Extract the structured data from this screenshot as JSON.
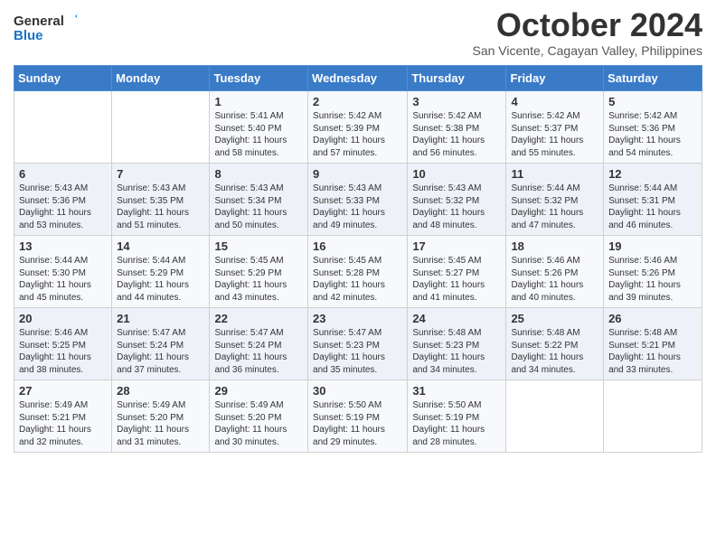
{
  "logo": {
    "line1": "General",
    "line2": "Blue"
  },
  "title": "October 2024",
  "subtitle": "San Vicente, Cagayan Valley, Philippines",
  "days_of_week": [
    "Sunday",
    "Monday",
    "Tuesday",
    "Wednesday",
    "Thursday",
    "Friday",
    "Saturday"
  ],
  "weeks": [
    [
      {
        "day": "",
        "content": ""
      },
      {
        "day": "",
        "content": ""
      },
      {
        "day": "1",
        "content": "Sunrise: 5:41 AM\nSunset: 5:40 PM\nDaylight: 11 hours and 58 minutes."
      },
      {
        "day": "2",
        "content": "Sunrise: 5:42 AM\nSunset: 5:39 PM\nDaylight: 11 hours and 57 minutes."
      },
      {
        "day": "3",
        "content": "Sunrise: 5:42 AM\nSunset: 5:38 PM\nDaylight: 11 hours and 56 minutes."
      },
      {
        "day": "4",
        "content": "Sunrise: 5:42 AM\nSunset: 5:37 PM\nDaylight: 11 hours and 55 minutes."
      },
      {
        "day": "5",
        "content": "Sunrise: 5:42 AM\nSunset: 5:36 PM\nDaylight: 11 hours and 54 minutes."
      }
    ],
    [
      {
        "day": "6",
        "content": "Sunrise: 5:43 AM\nSunset: 5:36 PM\nDaylight: 11 hours and 53 minutes."
      },
      {
        "day": "7",
        "content": "Sunrise: 5:43 AM\nSunset: 5:35 PM\nDaylight: 11 hours and 51 minutes."
      },
      {
        "day": "8",
        "content": "Sunrise: 5:43 AM\nSunset: 5:34 PM\nDaylight: 11 hours and 50 minutes."
      },
      {
        "day": "9",
        "content": "Sunrise: 5:43 AM\nSunset: 5:33 PM\nDaylight: 11 hours and 49 minutes."
      },
      {
        "day": "10",
        "content": "Sunrise: 5:43 AM\nSunset: 5:32 PM\nDaylight: 11 hours and 48 minutes."
      },
      {
        "day": "11",
        "content": "Sunrise: 5:44 AM\nSunset: 5:32 PM\nDaylight: 11 hours and 47 minutes."
      },
      {
        "day": "12",
        "content": "Sunrise: 5:44 AM\nSunset: 5:31 PM\nDaylight: 11 hours and 46 minutes."
      }
    ],
    [
      {
        "day": "13",
        "content": "Sunrise: 5:44 AM\nSunset: 5:30 PM\nDaylight: 11 hours and 45 minutes."
      },
      {
        "day": "14",
        "content": "Sunrise: 5:44 AM\nSunset: 5:29 PM\nDaylight: 11 hours and 44 minutes."
      },
      {
        "day": "15",
        "content": "Sunrise: 5:45 AM\nSunset: 5:29 PM\nDaylight: 11 hours and 43 minutes."
      },
      {
        "day": "16",
        "content": "Sunrise: 5:45 AM\nSunset: 5:28 PM\nDaylight: 11 hours and 42 minutes."
      },
      {
        "day": "17",
        "content": "Sunrise: 5:45 AM\nSunset: 5:27 PM\nDaylight: 11 hours and 41 minutes."
      },
      {
        "day": "18",
        "content": "Sunrise: 5:46 AM\nSunset: 5:26 PM\nDaylight: 11 hours and 40 minutes."
      },
      {
        "day": "19",
        "content": "Sunrise: 5:46 AM\nSunset: 5:26 PM\nDaylight: 11 hours and 39 minutes."
      }
    ],
    [
      {
        "day": "20",
        "content": "Sunrise: 5:46 AM\nSunset: 5:25 PM\nDaylight: 11 hours and 38 minutes."
      },
      {
        "day": "21",
        "content": "Sunrise: 5:47 AM\nSunset: 5:24 PM\nDaylight: 11 hours and 37 minutes."
      },
      {
        "day": "22",
        "content": "Sunrise: 5:47 AM\nSunset: 5:24 PM\nDaylight: 11 hours and 36 minutes."
      },
      {
        "day": "23",
        "content": "Sunrise: 5:47 AM\nSunset: 5:23 PM\nDaylight: 11 hours and 35 minutes."
      },
      {
        "day": "24",
        "content": "Sunrise: 5:48 AM\nSunset: 5:23 PM\nDaylight: 11 hours and 34 minutes."
      },
      {
        "day": "25",
        "content": "Sunrise: 5:48 AM\nSunset: 5:22 PM\nDaylight: 11 hours and 34 minutes."
      },
      {
        "day": "26",
        "content": "Sunrise: 5:48 AM\nSunset: 5:21 PM\nDaylight: 11 hours and 33 minutes."
      }
    ],
    [
      {
        "day": "27",
        "content": "Sunrise: 5:49 AM\nSunset: 5:21 PM\nDaylight: 11 hours and 32 minutes."
      },
      {
        "day": "28",
        "content": "Sunrise: 5:49 AM\nSunset: 5:20 PM\nDaylight: 11 hours and 31 minutes."
      },
      {
        "day": "29",
        "content": "Sunrise: 5:49 AM\nSunset: 5:20 PM\nDaylight: 11 hours and 30 minutes."
      },
      {
        "day": "30",
        "content": "Sunrise: 5:50 AM\nSunset: 5:19 PM\nDaylight: 11 hours and 29 minutes."
      },
      {
        "day": "31",
        "content": "Sunrise: 5:50 AM\nSunset: 5:19 PM\nDaylight: 11 hours and 28 minutes."
      },
      {
        "day": "",
        "content": ""
      },
      {
        "day": "",
        "content": ""
      }
    ]
  ]
}
